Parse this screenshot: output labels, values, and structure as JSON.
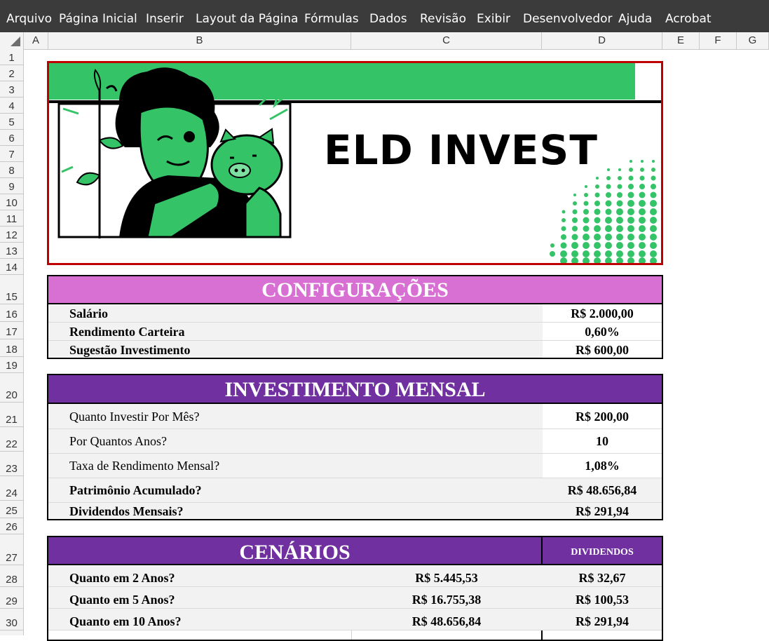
{
  "menu": [
    "Arquivo",
    "Página Inicial",
    "Inserir",
    "Layout da Página",
    "Fórmulas",
    "Dados",
    "Revisão",
    "Exibir",
    "Desenvolvedor",
    "Ajuda",
    "Acrobat"
  ],
  "columns": [
    "A",
    "B",
    "C",
    "D",
    "E",
    "F",
    "G"
  ],
  "rows": [
    "1",
    "2",
    "3",
    "4",
    "5",
    "6",
    "7",
    "8",
    "9",
    "10",
    "11",
    "12",
    "13",
    "14",
    "15",
    "16",
    "17",
    "18",
    "19",
    "20",
    "21",
    "22",
    "23",
    "24",
    "25",
    "26",
    "27",
    "28",
    "29",
    "30"
  ],
  "banner": {
    "title": "ELD INVEST"
  },
  "config": {
    "header": "CONFIGURAÇÕES",
    "rows": [
      {
        "label": "Salário",
        "value": "R$ 2.000,00"
      },
      {
        "label": "Rendimento Carteira",
        "value": "0,60%"
      },
      {
        "label": "Sugestão Investimento",
        "value": "R$ 600,00"
      }
    ]
  },
  "investimento": {
    "header": "INVESTIMENTO MENSAL",
    "rows": [
      {
        "label": "Quanto Investir Por Mês?",
        "value": "R$ 200,00"
      },
      {
        "label": "Por Quantos Anos?",
        "value": "10"
      },
      {
        "label": "Taxa de Rendimento Mensal?",
        "value": "1,08%"
      },
      {
        "label": "Patrimônio Acumulado?",
        "value": "R$ 48.656,84"
      },
      {
        "label": "Dividendos Mensais?",
        "value": "R$ 291,94"
      }
    ]
  },
  "cenarios": {
    "header": "CENÁRIOS",
    "subheader": "DIVIDENDOS",
    "rows": [
      {
        "label": "Quanto em 2 Anos?",
        "value": "R$ 5.445,53",
        "dividend": "R$ 32,67"
      },
      {
        "label": "Quanto em 5 Anos?",
        "value": "R$ 16.755,38",
        "dividend": "R$ 100,53"
      },
      {
        "label": "Quanto em 10 Anos?",
        "value": "R$ 48.656,84",
        "dividend": "R$ 291,94"
      }
    ]
  },
  "colors": {
    "ribbon": "#3b3b3b",
    "config_header": "#d86fd3",
    "purple_header": "#7030a0",
    "brand_green": "#34c467",
    "banner_border": "#c00000"
  }
}
